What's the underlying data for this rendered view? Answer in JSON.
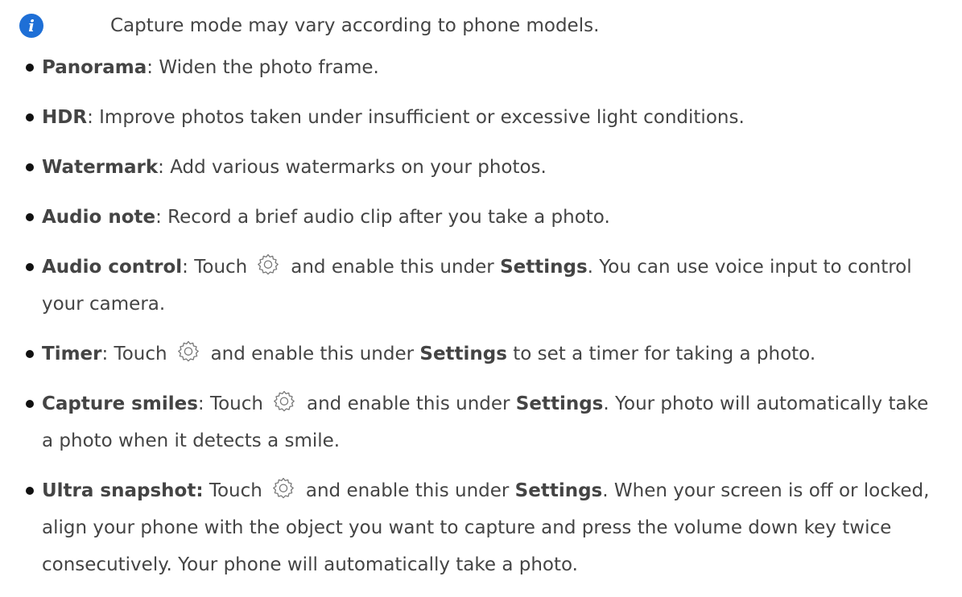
{
  "note": {
    "icon": "info-icon",
    "text": "Capture mode may vary according to phone models."
  },
  "modes": [
    {
      "term": "Panorama",
      "sep": ": ",
      "text": "Widen the photo frame."
    },
    {
      "term": "HDR",
      "sep": ": ",
      "text": "Improve photos taken under insufficient or excessive light conditions."
    },
    {
      "term": "Watermark",
      "sep": ": ",
      "text": "Add various watermarks on your photos."
    },
    {
      "term": "Audio note",
      "sep": ": ",
      "text": "Record a brief audio clip after you take a photo."
    },
    {
      "term": "Audio control",
      "sep": ": ",
      "pre": "Touch",
      "icon": "settings-gear-icon",
      "mid": "and enable this under",
      "settings": "Settings",
      "post": ". You can use voice input to control your camera."
    },
    {
      "term": "Timer",
      "sep": ": ",
      "pre": "Touch",
      "icon": "settings-gear-icon",
      "mid": "and enable this under",
      "settings": "Settings",
      "post": " to set a timer for taking a photo."
    },
    {
      "term": "Capture smiles",
      "sep": ": ",
      "pre": "Touch",
      "icon": "settings-gear-icon",
      "mid": "and enable this under",
      "settings": "Settings",
      "post": ". Your photo will automatically take a photo when it detects a smile."
    },
    {
      "term": "Ultra snapshot:",
      "sep": " ",
      "pre": "Touch",
      "icon": "settings-gear-icon",
      "mid": "and enable this under",
      "settings": "Settings",
      "post": ". When your screen is off or locked, align your phone with the object you want to capture and press the volume down key twice consecutively. Your phone will automatically take a photo."
    }
  ],
  "colors": {
    "text": "#444444",
    "bullet": "#111111",
    "info_icon": "#1e6fd6"
  }
}
